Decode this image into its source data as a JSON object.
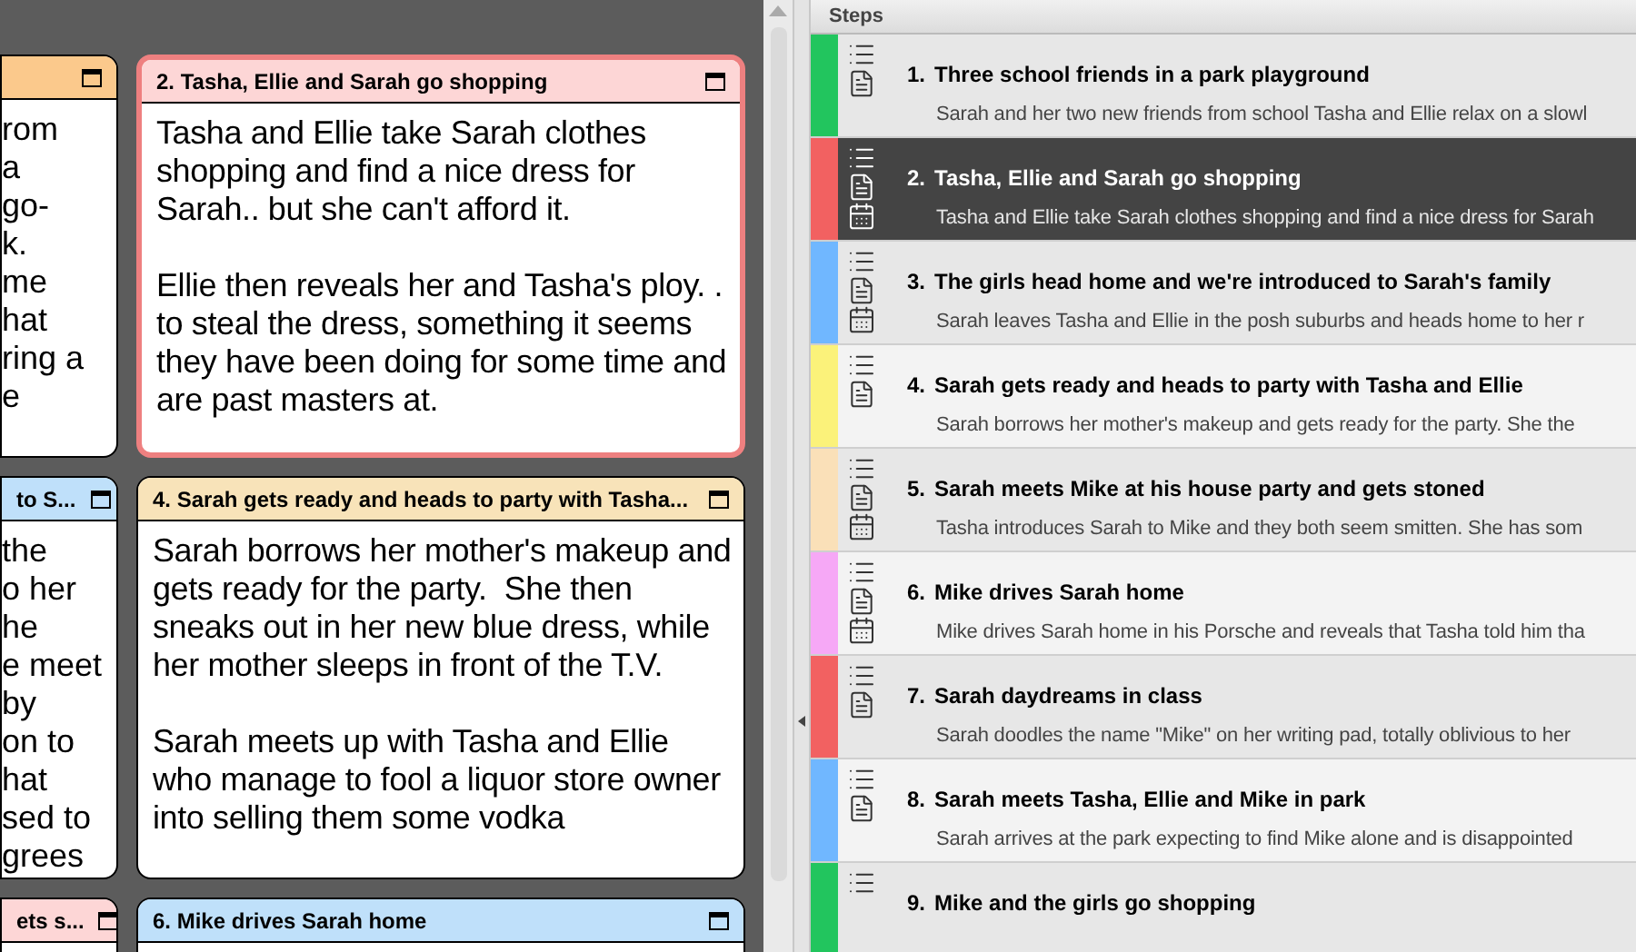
{
  "cards": [
    {
      "kind": "partial",
      "color": "#fbc98c",
      "selected": false,
      "lines": [
        "rom",
        "a",
        "go-",
        "k.",
        "me",
        "hat",
        "ring a",
        "e"
      ]
    },
    {
      "kind": "full",
      "title": "2. Tasha, Ellie and Sarah go shopping",
      "color": "#fdd6d6",
      "selected": true,
      "paragraphs": [
        "Tasha and Ellie take Sarah clothes shopping and find a nice dress for Sarah.. but she can't afford it.",
        "Ellie then reveals her and Tasha's ploy. . to steal the dress, something it seems they have been doing for some time and are past masters at."
      ]
    },
    {
      "kind": "partial",
      "title": "to S...",
      "color": "#bfe0fa",
      "selected": false,
      "lines": [
        "the",
        "o her",
        "he",
        "e meet",
        "by",
        "on to",
        "hat",
        "sed to",
        "grees"
      ]
    },
    {
      "kind": "full",
      "title": "4. Sarah gets ready and heads to party with Tasha...",
      "color": "#f8e3b9",
      "selected": false,
      "paragraphs": [
        "Sarah borrows her mother's makeup and gets ready for the party.  She then sneaks out in her new blue dress, while her mother sleeps in front of the T.V.",
        "Sarah meets up with Tasha and Ellie who manage to fool a liquor store owner into selling them some vodka"
      ]
    },
    {
      "kind": "partial",
      "title": "ets s...",
      "color": "#fdd6d6",
      "selected": false
    },
    {
      "kind": "full",
      "title": "6. Mike drives Sarah home",
      "color": "#bfe0fa",
      "selected": false
    }
  ],
  "steps_panel": {
    "title": "Steps",
    "steps": [
      {
        "number": "1.",
        "title": "Three school friends in a park playground",
        "description": "Sarah and her two new friends from school Tasha and Ellie relax on a slowl",
        "color": "#22c55e",
        "selected": false,
        "icons": [
          {
            "kind": "list"
          },
          {
            "kind": "note"
          }
        ]
      },
      {
        "number": "2.",
        "title": "Tasha, Ellie and Sarah go shopping",
        "description": "Tasha and Ellie take Sarah clothes shopping and find a nice dress for Sarah",
        "color": "#f26161",
        "selected": true,
        "icons": [
          {
            "kind": "list"
          },
          {
            "kind": "note"
          },
          {
            "kind": "calendar"
          }
        ]
      },
      {
        "number": "3.",
        "title": "The girls head home and we're introduced to Sarah's family",
        "description": "Sarah leaves Tasha and Ellie in the posh suburbs and heads home to her r",
        "color": "#70b7ff",
        "selected": false,
        "icons": [
          {
            "kind": "list"
          },
          {
            "kind": "note"
          },
          {
            "kind": "calendar"
          }
        ]
      },
      {
        "number": "4.",
        "title": "Sarah gets ready and heads to party with Tasha and Ellie",
        "description": "Sarah borrows her mother's makeup and gets ready for the party.  She the",
        "color": "#fbf27a",
        "selected": false,
        "icons": [
          {
            "kind": "list"
          },
          {
            "kind": "note"
          }
        ]
      },
      {
        "number": "5.",
        "title": "Sarah meets Mike at his house party and gets stoned",
        "description": "Tasha introduces Sarah to Mike and they both seem smitten.  She has som",
        "color": "#fae0b8",
        "selected": false,
        "icons": [
          {
            "kind": "list"
          },
          {
            "kind": "note"
          },
          {
            "kind": "calendar"
          }
        ]
      },
      {
        "number": "6.",
        "title": "Mike drives Sarah home",
        "description": "Mike drives Sarah home in his Porsche and reveals that Tasha told him tha",
        "color": "#f6a8f6",
        "selected": false,
        "icons": [
          {
            "kind": "list"
          },
          {
            "kind": "note"
          },
          {
            "kind": "calendar"
          }
        ]
      },
      {
        "number": "7.",
        "title": "Sarah daydreams in class",
        "description": "Sarah doodles the name \"Mike\" on her writing pad, totally oblivious to her",
        "color": "#f26161",
        "selected": false,
        "icons": [
          {
            "kind": "list"
          },
          {
            "kind": "note"
          }
        ]
      },
      {
        "number": "8.",
        "title": "Sarah meets Tasha, Ellie and Mike in park",
        "description": "Sarah arrives at the park expecting to find Mike alone and is disappointed",
        "color": "#70b7ff",
        "selected": false,
        "icons": [
          {
            "kind": "list"
          },
          {
            "kind": "note"
          }
        ]
      },
      {
        "number": "9.",
        "title": "Mike and the girls go shopping",
        "color": "#22c55e",
        "selected": false,
        "icons": [
          {
            "kind": "list"
          }
        ]
      }
    ]
  }
}
